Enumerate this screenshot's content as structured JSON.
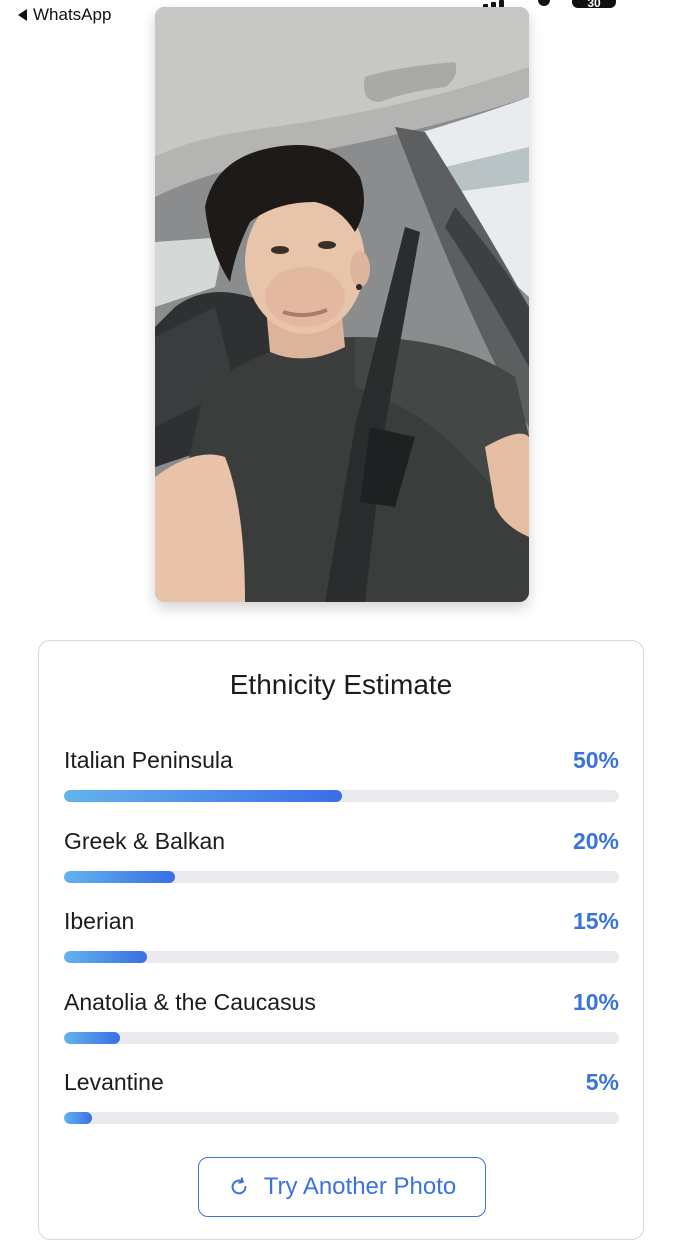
{
  "status_bar": {
    "back_label": "WhatsApp",
    "battery": "30"
  },
  "photo": {
    "description_icon": "selfie-photo"
  },
  "card": {
    "title": "Ethnicity Estimate",
    "rows": [
      {
        "label": "Italian Peninsula",
        "percent_text": "50%",
        "value": 50
      },
      {
        "label": "Greek & Balkan",
        "percent_text": "20%",
        "value": 20
      },
      {
        "label": "Iberian",
        "percent_text": "15%",
        "value": 15
      },
      {
        "label": "Anatolia & the Caucasus",
        "percent_text": "10%",
        "value": 10
      },
      {
        "label": "Levantine",
        "percent_text": "5%",
        "value": 5
      }
    ],
    "retry_button": {
      "label": "Try Another Photo",
      "icon": "refresh-icon"
    }
  },
  "colors": {
    "accent": "#3a72e0",
    "bar_start": "#63b3ec",
    "bar_end": "#3a6ee6",
    "track": "#e9e9ee"
  }
}
